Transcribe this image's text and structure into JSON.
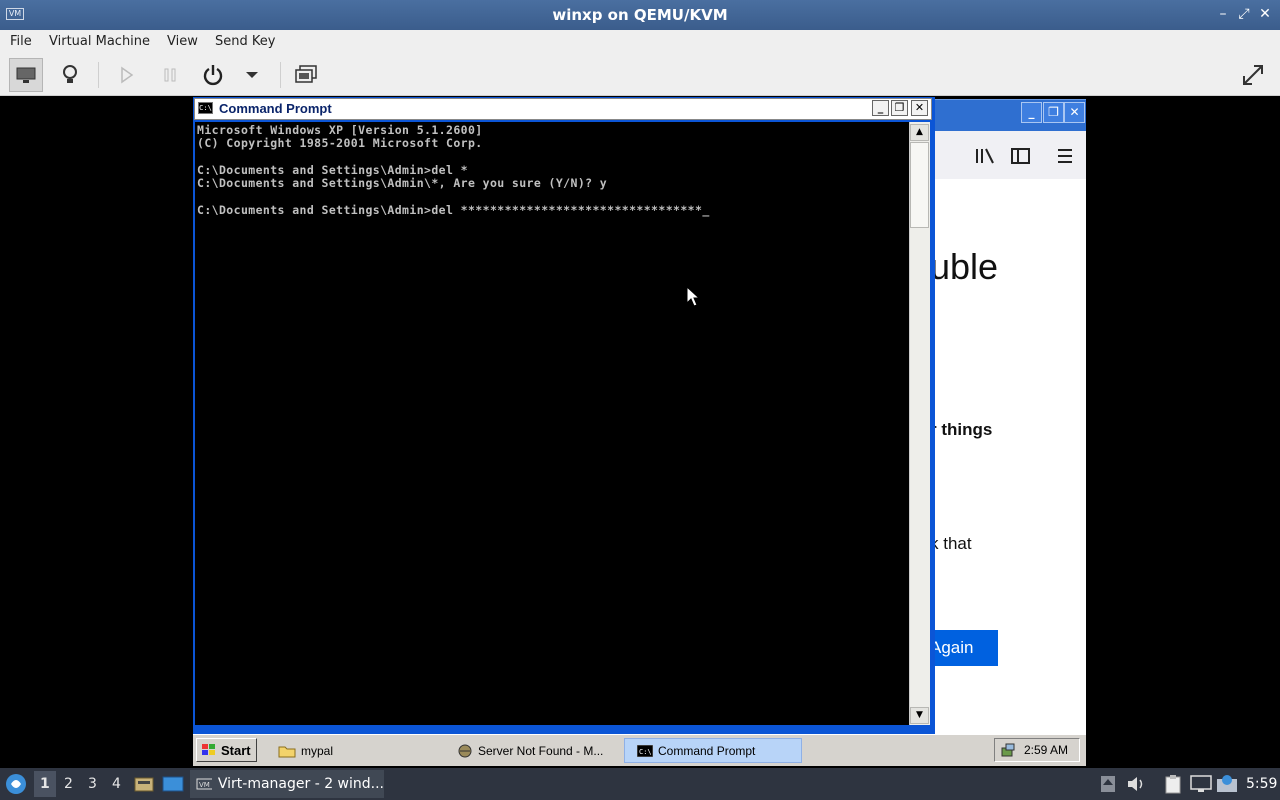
{
  "host": {
    "title": "winxp on QEMU/KVM",
    "menu": [
      "File",
      "Virtual Machine",
      "View",
      "Send Key"
    ]
  },
  "cmd": {
    "title": "Command Prompt",
    "lines": [
      "Microsoft Windows XP [Version 5.1.2600]",
      "(C) Copyright 1985-2001 Microsoft Corp.",
      "",
      "C:\\Documents and Settings\\Admin>del *",
      "C:\\Documents and Settings\\Admin\\*, Are you sure (Y/N)? y",
      "",
      "C:\\Documents and Settings\\Admin>del *********************************_"
    ]
  },
  "browser": {
    "heading_fragment": "uble",
    "text_fragment_1": "r things",
    "text_fragment_2": "k that",
    "button_fragment": "Again"
  },
  "guest_taskbar": {
    "start_label": "Start",
    "tasks": [
      "mypal",
      "Server Not Found - M...",
      "Command Prompt"
    ],
    "clock": "2:59 AM"
  },
  "host_panel": {
    "workspaces": [
      "1",
      "2",
      "3",
      "4"
    ],
    "task_label": "Virt-manager - 2 wind...",
    "clock": "5:59"
  }
}
